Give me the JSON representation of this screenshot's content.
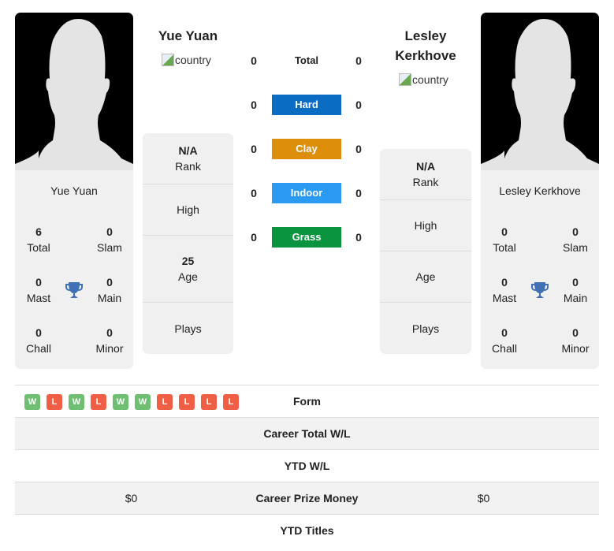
{
  "left_player": {
    "name": "Yue Yuan",
    "country_alt": "country",
    "card_name": "Yue Yuan",
    "titles": {
      "total": {
        "value": "6",
        "label": "Total"
      },
      "slam": {
        "value": "0",
        "label": "Slam"
      },
      "mast": {
        "value": "0",
        "label": "Mast"
      },
      "main": {
        "value": "0",
        "label": "Main"
      },
      "chall": {
        "value": "0",
        "label": "Chall"
      },
      "minor": {
        "value": "0",
        "label": "Minor"
      }
    },
    "info": {
      "rank": {
        "value": "N/A",
        "label": "Rank"
      },
      "high": {
        "value": "",
        "label": "High"
      },
      "age": {
        "value": "25",
        "label": "Age"
      },
      "plays": {
        "value": "",
        "label": "Plays"
      }
    }
  },
  "right_player": {
    "name": "Lesley Kerkhove",
    "country_alt": "country",
    "card_name": "Lesley Kerkhove",
    "titles": {
      "total": {
        "value": "0",
        "label": "Total"
      },
      "slam": {
        "value": "0",
        "label": "Slam"
      },
      "mast": {
        "value": "0",
        "label": "Mast"
      },
      "main": {
        "value": "0",
        "label": "Main"
      },
      "chall": {
        "value": "0",
        "label": "Chall"
      },
      "minor": {
        "value": "0",
        "label": "Minor"
      }
    },
    "info": {
      "rank": {
        "value": "N/A",
        "label": "Rank"
      },
      "high": {
        "value": "",
        "label": "High"
      },
      "age": {
        "value": "",
        "label": "Age"
      },
      "plays": {
        "value": "",
        "label": "Plays"
      }
    }
  },
  "surfaces": [
    {
      "label": "Total",
      "left": "0",
      "right": "0",
      "color": ""
    },
    {
      "label": "Hard",
      "left": "0",
      "right": "0",
      "color": "#0a6cc2"
    },
    {
      "label": "Clay",
      "left": "0",
      "right": "0",
      "color": "#dd8f0b"
    },
    {
      "label": "Indoor",
      "left": "0",
      "right": "0",
      "color": "#2a9af2"
    },
    {
      "label": "Grass",
      "left": "0",
      "right": "0",
      "color": "#0b9440"
    }
  ],
  "colors": {
    "win": "#6fbf73",
    "loss": "#ee5f45",
    "trophy": "#3f6fb5"
  },
  "stats": {
    "form": {
      "label": "Form",
      "left_results": [
        "W",
        "L",
        "W",
        "L",
        "W",
        "W",
        "L",
        "L",
        "L",
        "L"
      ]
    },
    "career_total_wl": {
      "label": "Career Total W/L",
      "left": "",
      "right": ""
    },
    "ytd_wl": {
      "label": "YTD W/L",
      "left": "",
      "right": ""
    },
    "career_prize_money": {
      "label": "Career Prize Money",
      "left": "$0",
      "right": "$0"
    },
    "ytd_titles": {
      "label": "YTD Titles",
      "left": "",
      "right": ""
    }
  }
}
